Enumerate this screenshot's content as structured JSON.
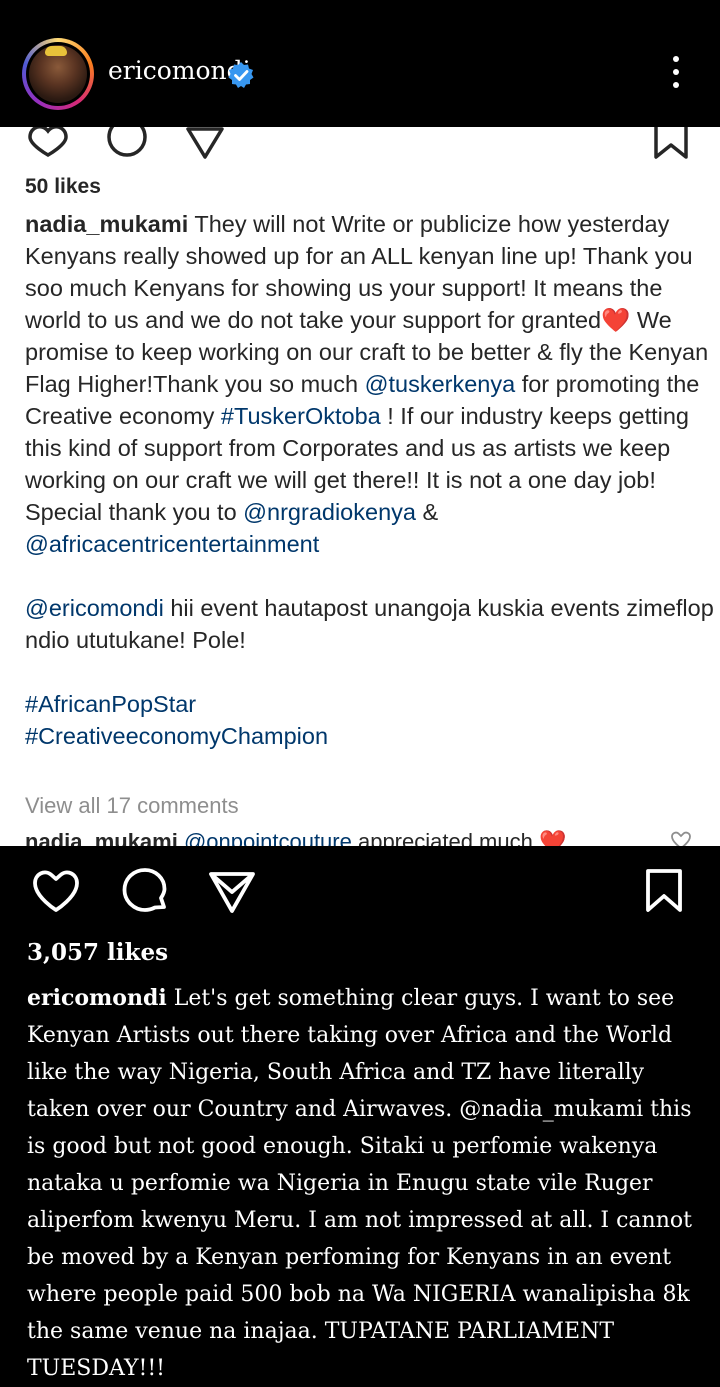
{
  "header": {
    "username": "ericomondi",
    "verified_color": "#3897f0",
    "menu_icon": "more-vertical-icon"
  },
  "post1": {
    "likes": "50 likes",
    "caption_user": "nadia_mukami",
    "caption_parts": {
      "p1a": "They will not Write or publicize how yesterday Kenyans really showed up for an ALL kenyan line up! Thank you soo much Kenyans for showing us your support! It means the world to us and we do not take your support for granted",
      "heart": "❤️",
      "p1b": " We promise to keep working on our craft to be better & fly the Kenyan Flag Higher!Thank you so much ",
      "m1": "@tuskerkenya",
      "p1c": " for promoting the Creative economy ",
      "m2": "#TuskerOktoba",
      "p1d": " ! If our industry keeps getting this kind of support from Corporates and us as artists we keep working on our craft we will get there!! It is not a one day job!",
      "p2a": "Special thank you to ",
      "m3": "@nrgradiokenya",
      "p2b": " & ",
      "m4": "@africacentricentertainment",
      "m5": "@ericomondi",
      "p3": " hii event hautapost unangoja kuskia events zimeflop ndio ututukane! Pole!",
      "h1": "#AfricanPopStar",
      "h2": "#CreativeeconomyChampion"
    },
    "view_all": "View all 17 comments",
    "comment_user": "nadia_mukami",
    "comment_mention": "@onpointcouture",
    "comment_text": " appreciated much ",
    "comment_heart": "❤️"
  },
  "post2": {
    "likes": "3,057 likes",
    "caption_user": "ericomondi",
    "caption_text": "Let's get something clear guys. I want to see Kenyan Artists out there taking over Africa and the World like the way Nigeria, South Africa and TZ have literally taken over our Country and Airwaves. @nadia_mukami this is good but not good enough. Sitaki u perfomie wakenya nataka u perfomie wa Nigeria in Enugu state vile Ruger aliperfom kwenyu Meru. I am not impressed at all. I cannot be moved by a Kenyan perfoming for Kenyans in an event where people paid 500 bob na Wa NIGERIA wanalipisha 8k the same venue na inajaa. TUPATANE PARLIAMENT TUESDAY!!!"
  },
  "colors": {
    "mention": "#00376b",
    "heart_red": "#ed4956",
    "muted": "#8e8e8e"
  }
}
